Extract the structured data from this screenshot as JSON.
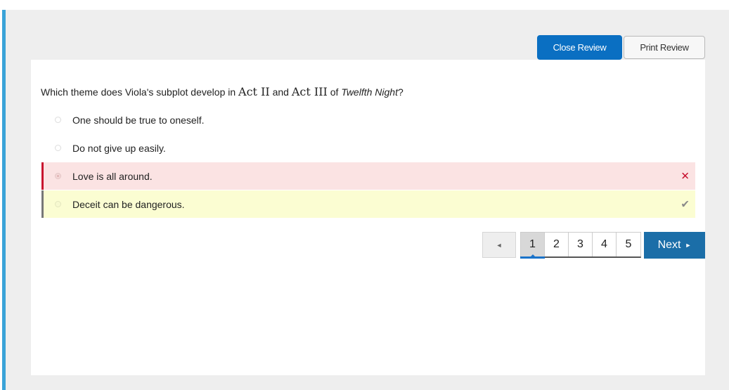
{
  "toolbar": {
    "close_label": "Close Review",
    "print_label": "Print Review"
  },
  "question": {
    "prefix": "Which theme does Viola's subplot develop in ",
    "act_a": "Act II",
    "mid": " and ",
    "act_b": "Act III",
    "of": " of ",
    "title": "Twelfth Night",
    "suffix": "?"
  },
  "choices": [
    {
      "label": "One should be true to oneself.",
      "state": "neutral"
    },
    {
      "label": "Do not give up easily.",
      "state": "neutral"
    },
    {
      "label": "Love is all around.",
      "state": "selected-wrong",
      "mark_icon": "x-icon",
      "mark": "✕"
    },
    {
      "label": "Deceit can be dangerous.",
      "state": "correct",
      "mark_icon": "check-icon",
      "mark": "✔"
    }
  ],
  "pager": {
    "prev": "◄",
    "pages": [
      "1",
      "2",
      "3",
      "4",
      "5"
    ],
    "current": "1",
    "next_label": "Next",
    "next_arrow": "►"
  },
  "colors": {
    "accent_blue": "#0a6fc2",
    "next_blue": "#1b6ea8",
    "wrong_bg": "#fbe3e3",
    "wrong_border": "#c8102e",
    "correct_bg": "#fbfdd2",
    "rail": "#3aa3d8"
  }
}
